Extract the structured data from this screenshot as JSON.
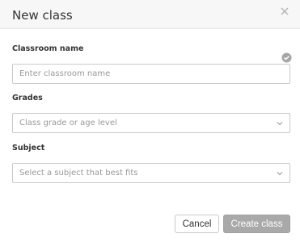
{
  "dialog": {
    "title": "New class"
  },
  "form": {
    "classroom_name": {
      "label": "Classroom name",
      "placeholder": "Enter classroom name",
      "value": ""
    },
    "grades": {
      "label": "Grades",
      "placeholder": "Class grade or age level"
    },
    "subject": {
      "label": "Subject",
      "placeholder": "Select a subject that best fits"
    }
  },
  "actions": {
    "cancel_label": "Cancel",
    "create_label": "Create class"
  },
  "colors": {
    "header_bg": "#f7f7f7",
    "create_button_disabled": "#a9a9a9",
    "check_icon": "#a6a6a6"
  }
}
